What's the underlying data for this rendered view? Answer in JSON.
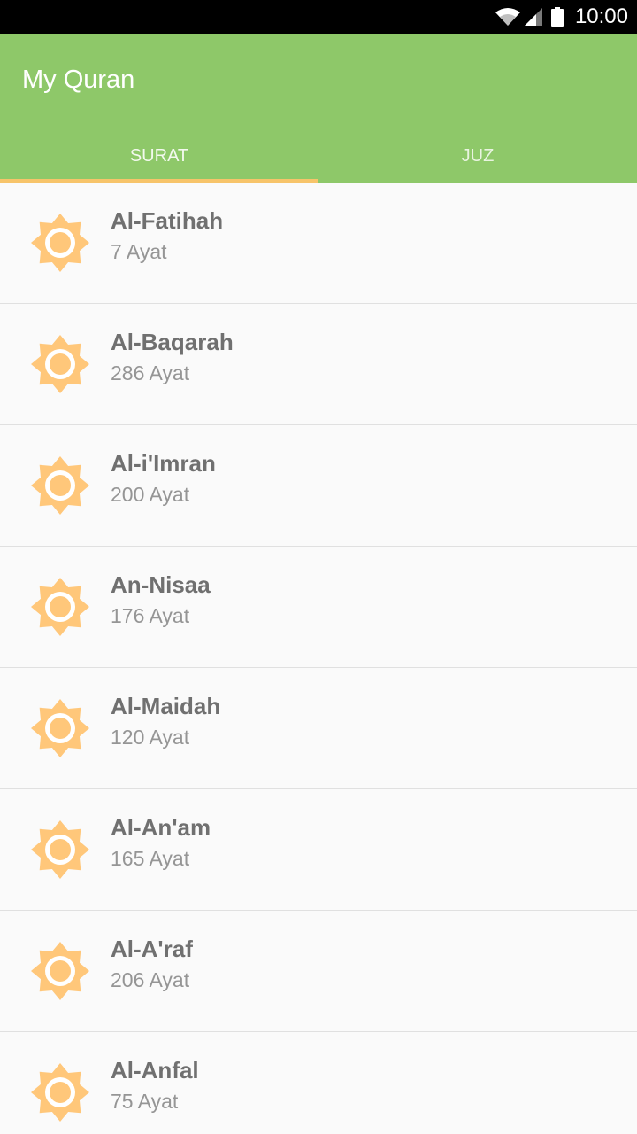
{
  "status_bar": {
    "time": "10:00",
    "icons": [
      "wifi-icon",
      "signal-icon",
      "battery-icon"
    ]
  },
  "app_bar": {
    "title": "My Quran",
    "color": "#8ec869"
  },
  "tabs": [
    {
      "label": "SURAT",
      "selected": true
    },
    {
      "label": "JUZ",
      "selected": false
    }
  ],
  "accent_color": "#f7c46a",
  "surat_list": [
    {
      "name": "Al-Fatihah",
      "ayat": "7 Ayat",
      "icon": "sun-icon"
    },
    {
      "name": "Al-Baqarah",
      "ayat": "286 Ayat",
      "icon": "sun-icon"
    },
    {
      "name": "Al-i'Imran",
      "ayat": "200 Ayat",
      "icon": "sun-icon"
    },
    {
      "name": "An-Nisaa",
      "ayat": "176 Ayat",
      "icon": "sun-icon"
    },
    {
      "name": "Al-Maidah",
      "ayat": "120 Ayat",
      "icon": "sun-icon"
    },
    {
      "name": "Al-An'am",
      "ayat": "165 Ayat",
      "icon": "sun-icon"
    },
    {
      "name": "Al-A'raf",
      "ayat": "206 Ayat",
      "icon": "sun-icon"
    },
    {
      "name": "Al-Anfal",
      "ayat": "75 Ayat",
      "icon": "sun-icon"
    }
  ]
}
